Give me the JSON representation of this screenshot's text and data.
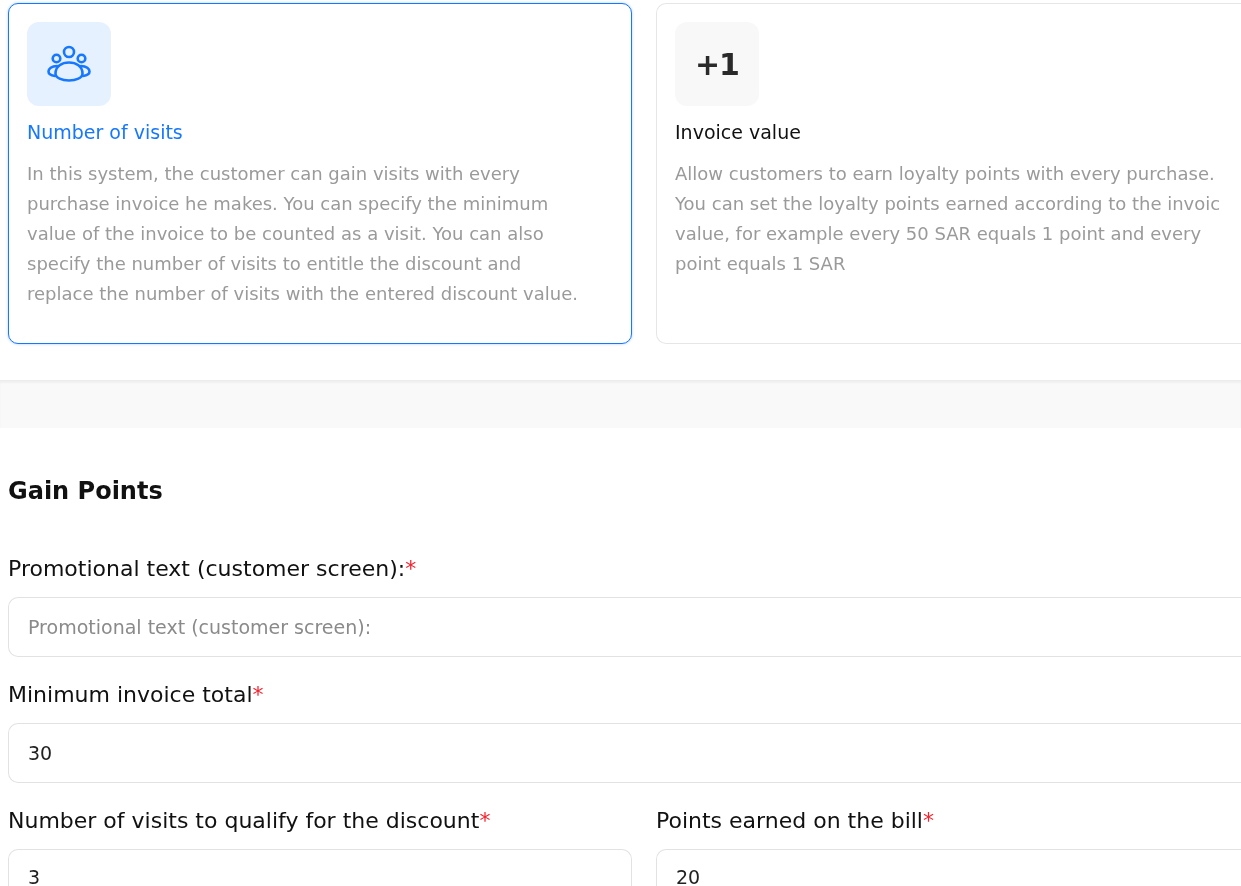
{
  "cards": [
    {
      "kind": "icon",
      "title": "Number of visits",
      "description": "In this system, the customer can gain visits with every\npurchase invoice he makes. You can specify the minimum\nvalue of the invoice to be counted as a visit. You can also\nspecify the number of visits to entitle the discount and\nreplace the number of visits with the entered discount value.",
      "selected": true
    },
    {
      "kind": "text",
      "badge": "+1",
      "title": "Invoice value",
      "description": "Allow customers to earn loyalty points with every purchase.\nYou can set the loyalty points earned according to the invoic\nvalue, for example every 50 SAR equals 1 point and every\npoint equals 1 SAR",
      "selected": false
    }
  ],
  "section": {
    "title": "Gain Points"
  },
  "rows": [
    {
      "fields": [
        {
          "label": "Promotional text (customer screen):",
          "required_mark": "*",
          "placeholder": "Promotional text (customer screen):"
        }
      ]
    },
    {
      "fields": [
        {
          "label": "Minimum invoice total",
          "required_mark": "*",
          "value": "30"
        }
      ]
    },
    {
      "fields": [
        {
          "label": "Number of visits to qualify for the discount",
          "required_mark": "*",
          "value": "3"
        },
        {
          "label": "Points earned on the bill",
          "required_mark": "*",
          "value": "20"
        }
      ]
    }
  ]
}
